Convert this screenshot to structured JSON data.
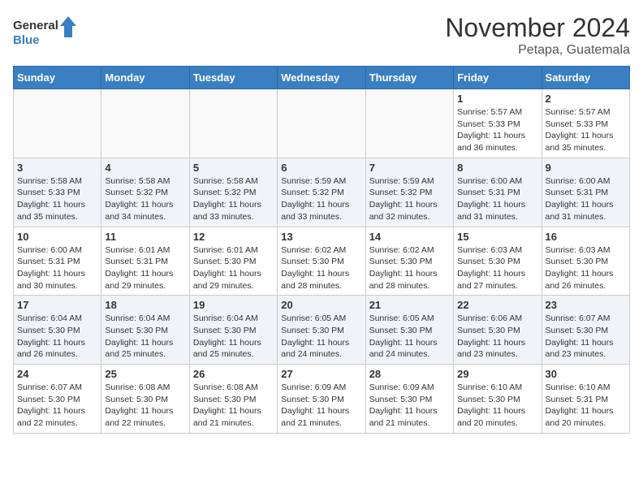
{
  "header": {
    "logo_line1": "General",
    "logo_line2": "Blue",
    "month": "November 2024",
    "location": "Petapa, Guatemala"
  },
  "weekdays": [
    "Sunday",
    "Monday",
    "Tuesday",
    "Wednesday",
    "Thursday",
    "Friday",
    "Saturday"
  ],
  "weeks": [
    [
      {
        "day": "",
        "info": ""
      },
      {
        "day": "",
        "info": ""
      },
      {
        "day": "",
        "info": ""
      },
      {
        "day": "",
        "info": ""
      },
      {
        "day": "",
        "info": ""
      },
      {
        "day": "1",
        "info": "Sunrise: 5:57 AM\nSunset: 5:33 PM\nDaylight: 11 hours\nand 36 minutes."
      },
      {
        "day": "2",
        "info": "Sunrise: 5:57 AM\nSunset: 5:33 PM\nDaylight: 11 hours\nand 35 minutes."
      }
    ],
    [
      {
        "day": "3",
        "info": "Sunrise: 5:58 AM\nSunset: 5:33 PM\nDaylight: 11 hours\nand 35 minutes."
      },
      {
        "day": "4",
        "info": "Sunrise: 5:58 AM\nSunset: 5:32 PM\nDaylight: 11 hours\nand 34 minutes."
      },
      {
        "day": "5",
        "info": "Sunrise: 5:58 AM\nSunset: 5:32 PM\nDaylight: 11 hours\nand 33 minutes."
      },
      {
        "day": "6",
        "info": "Sunrise: 5:59 AM\nSunset: 5:32 PM\nDaylight: 11 hours\nand 33 minutes."
      },
      {
        "day": "7",
        "info": "Sunrise: 5:59 AM\nSunset: 5:32 PM\nDaylight: 11 hours\nand 32 minutes."
      },
      {
        "day": "8",
        "info": "Sunrise: 6:00 AM\nSunset: 5:31 PM\nDaylight: 11 hours\nand 31 minutes."
      },
      {
        "day": "9",
        "info": "Sunrise: 6:00 AM\nSunset: 5:31 PM\nDaylight: 11 hours\nand 31 minutes."
      }
    ],
    [
      {
        "day": "10",
        "info": "Sunrise: 6:00 AM\nSunset: 5:31 PM\nDaylight: 11 hours\nand 30 minutes."
      },
      {
        "day": "11",
        "info": "Sunrise: 6:01 AM\nSunset: 5:31 PM\nDaylight: 11 hours\nand 29 minutes."
      },
      {
        "day": "12",
        "info": "Sunrise: 6:01 AM\nSunset: 5:30 PM\nDaylight: 11 hours\nand 29 minutes."
      },
      {
        "day": "13",
        "info": "Sunrise: 6:02 AM\nSunset: 5:30 PM\nDaylight: 11 hours\nand 28 minutes."
      },
      {
        "day": "14",
        "info": "Sunrise: 6:02 AM\nSunset: 5:30 PM\nDaylight: 11 hours\nand 28 minutes."
      },
      {
        "day": "15",
        "info": "Sunrise: 6:03 AM\nSunset: 5:30 PM\nDaylight: 11 hours\nand 27 minutes."
      },
      {
        "day": "16",
        "info": "Sunrise: 6:03 AM\nSunset: 5:30 PM\nDaylight: 11 hours\nand 26 minutes."
      }
    ],
    [
      {
        "day": "17",
        "info": "Sunrise: 6:04 AM\nSunset: 5:30 PM\nDaylight: 11 hours\nand 26 minutes."
      },
      {
        "day": "18",
        "info": "Sunrise: 6:04 AM\nSunset: 5:30 PM\nDaylight: 11 hours\nand 25 minutes."
      },
      {
        "day": "19",
        "info": "Sunrise: 6:04 AM\nSunset: 5:30 PM\nDaylight: 11 hours\nand 25 minutes."
      },
      {
        "day": "20",
        "info": "Sunrise: 6:05 AM\nSunset: 5:30 PM\nDaylight: 11 hours\nand 24 minutes."
      },
      {
        "day": "21",
        "info": "Sunrise: 6:05 AM\nSunset: 5:30 PM\nDaylight: 11 hours\nand 24 minutes."
      },
      {
        "day": "22",
        "info": "Sunrise: 6:06 AM\nSunset: 5:30 PM\nDaylight: 11 hours\nand 23 minutes."
      },
      {
        "day": "23",
        "info": "Sunrise: 6:07 AM\nSunset: 5:30 PM\nDaylight: 11 hours\nand 23 minutes."
      }
    ],
    [
      {
        "day": "24",
        "info": "Sunrise: 6:07 AM\nSunset: 5:30 PM\nDaylight: 11 hours\nand 22 minutes."
      },
      {
        "day": "25",
        "info": "Sunrise: 6:08 AM\nSunset: 5:30 PM\nDaylight: 11 hours\nand 22 minutes."
      },
      {
        "day": "26",
        "info": "Sunrise: 6:08 AM\nSunset: 5:30 PM\nDaylight: 11 hours\nand 21 minutes."
      },
      {
        "day": "27",
        "info": "Sunrise: 6:09 AM\nSunset: 5:30 PM\nDaylight: 11 hours\nand 21 minutes."
      },
      {
        "day": "28",
        "info": "Sunrise: 6:09 AM\nSunset: 5:30 PM\nDaylight: 11 hours\nand 21 minutes."
      },
      {
        "day": "29",
        "info": "Sunrise: 6:10 AM\nSunset: 5:30 PM\nDaylight: 11 hours\nand 20 minutes."
      },
      {
        "day": "30",
        "info": "Sunrise: 6:10 AM\nSunset: 5:31 PM\nDaylight: 11 hours\nand 20 minutes."
      }
    ]
  ]
}
